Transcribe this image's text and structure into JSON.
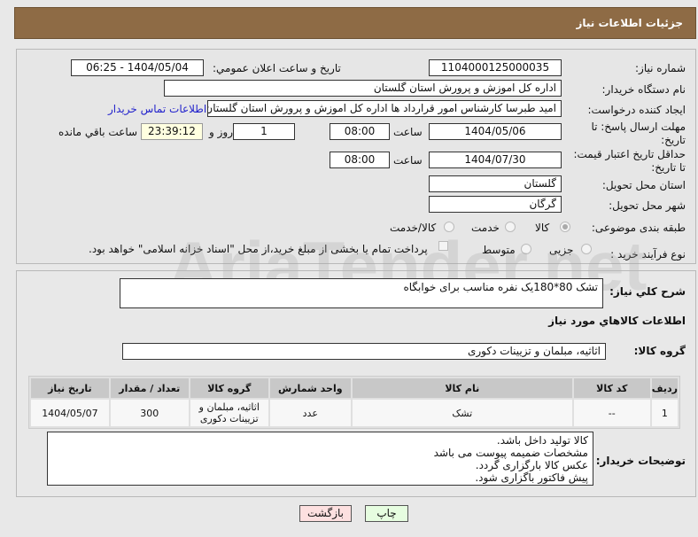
{
  "header": {
    "title": "جزئیات اطلاعات نیاز"
  },
  "form": {
    "need_number_label": "شماره نیاز:",
    "need_number": "1104000125000035",
    "announce_label": "تاریخ و ساعت اعلان عمومي:",
    "announce_value": "1404/05/04 - 06:25",
    "buyer_org_label": "نام دستگاه خریدار:",
    "buyer_org": "اداره کل اموزش و پرورش استان گلستان",
    "creator_label": "ایجاد کننده درخواست:",
    "creator": "امید طبرسا کارشناس امور قرارداد ها اداره کل اموزش و پرورش استان گلستان",
    "contact_link": "اطلاعات تماس خریدار",
    "deadline_label": "مهلت ارسال پاسخ: تا تاریخ:",
    "deadline_date": "1404/05/06",
    "time_label": "ساعت",
    "deadline_time": "08:00",
    "days": "1",
    "days_label": "روز و",
    "remaining": "23:39:12",
    "remaining_label": "ساعت باقي مانده",
    "validity_label": "حداقل تاریخ اعتبار قیمت: تا تاریخ:",
    "validity_date": "1404/07/30",
    "validity_time": "08:00",
    "province_label": "استان محل تحویل:",
    "province": "گلستان",
    "city_label": "شهر محل تحویل:",
    "city": "گرگان",
    "category_label": "طبقه بندی موضوعی:",
    "category_options": [
      "کالا",
      "خدمت",
      "کالا/خدمت"
    ],
    "process_label": "نوع فرآیند خرید :",
    "process_options": [
      "جزیی",
      "متوسط"
    ],
    "payment_note": "پرداخت تمام یا بخشی از مبلغ خرید،از محل \"اسناد خزانه اسلامی\" خواهد بود."
  },
  "details": {
    "description_label": "شرح کلي نیاز:",
    "description": "تشک 80*180یک نفره مناسب برای خوابگاه",
    "goods_title": "اطلاعات کالاهاي مورد نیاز",
    "group_label": "گروه کالا:",
    "group": "اثاثیه، مبلمان و تزیینات دکوری",
    "table": {
      "headers": [
        "ردیف",
        "کد کالا",
        "نام کالا",
        "واحد شمارش",
        "گروه کالا",
        "تعداد / مقدار",
        "تاریخ نیاز"
      ],
      "rows": [
        [
          "1",
          "--",
          "تشک",
          "عدد",
          "اثاثیه، مبلمان و تزیینات دکوری",
          "300",
          "1404/05/07"
        ]
      ]
    },
    "notes_label": "توضیحات خریدار:",
    "notes": [
      "کالا تولید داخل باشد.",
      "مشخصات ضمیمه پیوست می باشد",
      "عکس کالا بارگزاری گردد.",
      "پیش فاکتور باگزاری شود."
    ]
  },
  "buttons": {
    "back": "بازگشت",
    "print": "چاپ"
  },
  "watermark": "AriaTender.net"
}
